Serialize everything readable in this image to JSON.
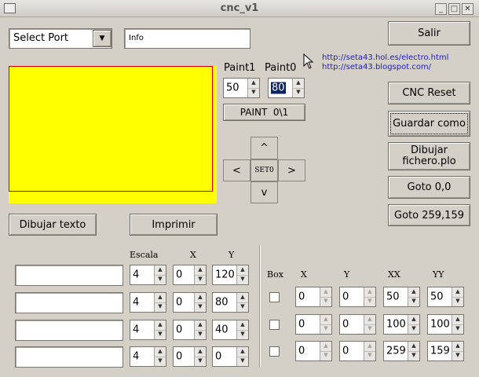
{
  "window": {
    "title": "cnc_v1"
  },
  "port": {
    "selected": "Select Port"
  },
  "info": {
    "value": "Info"
  },
  "buttons": {
    "salir": "Salir",
    "cnc_reset": "CNC Reset",
    "guardar_como": "Guardar como",
    "dibujar_fichero_l1": "Dibujar",
    "dibujar_fichero_l2": "fichero.plo",
    "goto_00": "Goto 0,0",
    "goto_259": "Goto 259,159",
    "dibujar_texto": "Dibujar texto",
    "imprimir": "Imprimir",
    "paint_toggle": "PAINT  0\\1"
  },
  "links": {
    "link1": "http://seta43.hol.es/electro.html",
    "link2": "http://seta43.blogspot.com/"
  },
  "paint": {
    "paint1_label": "Paint1",
    "paint0_label": "Paint0",
    "paint1_value": "50",
    "paint0_value": "80"
  },
  "jog": {
    "up": "^",
    "left": "<",
    "center": "SET0",
    "right": ">",
    "down": "v"
  },
  "text_table": {
    "headers": {
      "escala": "Escala",
      "x": "X",
      "y": "Y"
    },
    "rows": [
      {
        "text": "",
        "escala": "4",
        "x": "0",
        "y": "120"
      },
      {
        "text": "",
        "escala": "4",
        "x": "0",
        "y": "80"
      },
      {
        "text": "",
        "escala": "4",
        "x": "0",
        "y": "40"
      },
      {
        "text": "",
        "escala": "4",
        "x": "0",
        "y": "0"
      }
    ]
  },
  "box_table": {
    "headers": {
      "box": "Box",
      "x": "X",
      "y": "Y",
      "xx": "XX",
      "yy": "YY"
    },
    "rows": [
      {
        "x": "0",
        "y": "0",
        "xx": "50",
        "yy": "50"
      },
      {
        "x": "0",
        "y": "0",
        "xx": "100",
        "yy": "100"
      },
      {
        "x": "0",
        "y": "0",
        "xx": "259",
        "yy": "159"
      }
    ]
  },
  "colors": {
    "canvas": "#ffff00",
    "canvas_border": "#d40000",
    "link": "#1a1ad6"
  }
}
